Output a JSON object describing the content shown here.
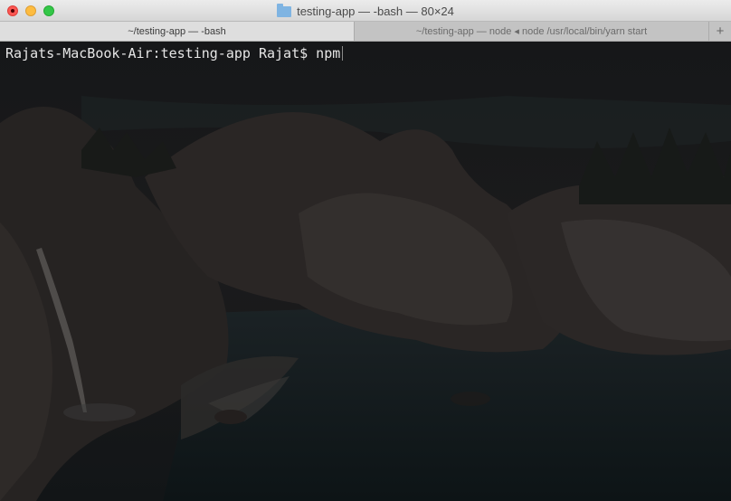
{
  "window": {
    "title": "testing-app — -bash — 80×24",
    "controls": [
      "close",
      "minimize",
      "zoom"
    ]
  },
  "tabs": [
    {
      "label": "~/testing-app — -bash",
      "path": "~/testing-app",
      "process": "-bash",
      "active": true
    },
    {
      "label": "~/testing-app — node ◂ node /usr/local/bin/yarn start",
      "path": "~/testing-app",
      "process": "node ◂ node /usr/local/bin/yarn start",
      "active": false
    }
  ],
  "new_tab_label": "+",
  "terminal": {
    "prompt": "Rajats-MacBook-Air:testing-app Rajat$ ",
    "input": "npm"
  },
  "colors": {
    "close": "#fc5753",
    "minimize": "#fdbc40",
    "zoom": "#33c748",
    "terminal_text": "#e6e6e6"
  }
}
